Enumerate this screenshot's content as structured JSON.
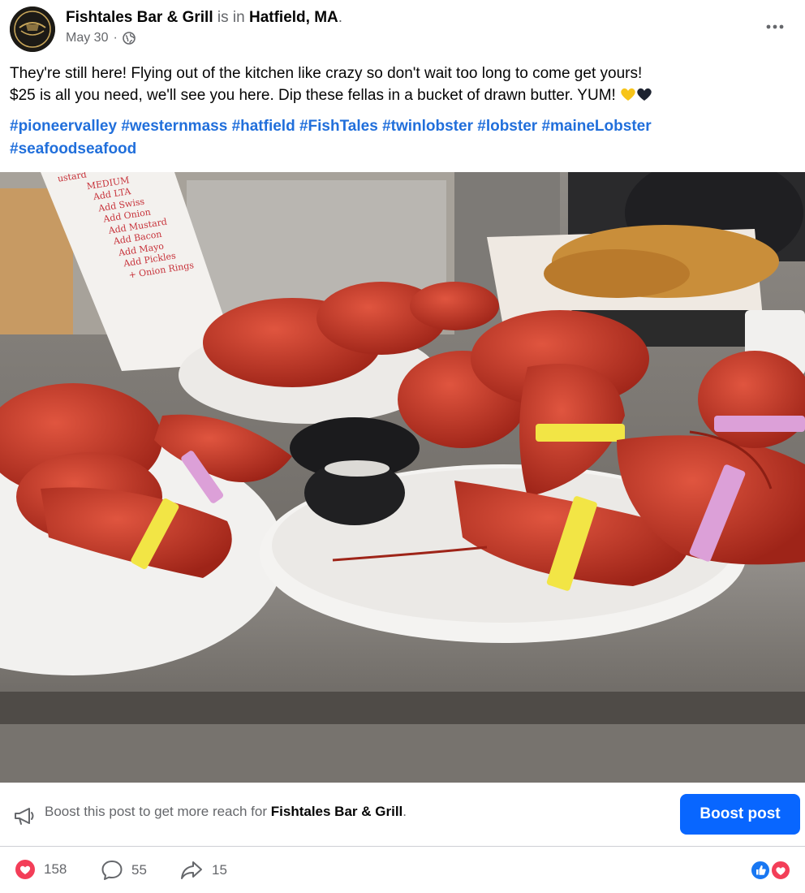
{
  "post": {
    "author": "Fishtales Bar & Grill",
    "is_in_text": "is in",
    "location": "Hatfield, MA",
    "period": ".",
    "date": "May 30",
    "dot": "·",
    "audience_icon": "globe-icon",
    "more_icon": "more-options-icon",
    "text_line1": "They're still here! Flying out of the kitchen like crazy so don't wait too long to come get yours!",
    "text_line2": "$25 is all you need, we'll see you here. Dip these fellas in a bucket of drawn butter. YUM!",
    "emojis": [
      "yellow-heart-icon",
      "black-heart-icon"
    ],
    "hashtags": [
      "#pioneervalley",
      "#westernmass",
      "#hatfield",
      "#FishTales",
      "#twinlobster",
      "#lobster",
      "#maineLobster",
      "#seafoodseafood"
    ]
  },
  "photo": {
    "menu_card_lines": [
      "ustard",
      "MEDIUM",
      "Add LTA",
      "Add Swiss",
      "Add Onion",
      "Add Mustard",
      "Add Bacon",
      "Add Mayo",
      "Add Pickles",
      "+ Onion Rings"
    ]
  },
  "boost": {
    "prefix": "Boost this post to get more reach for",
    "page": "Fishtales Bar & Grill",
    "suffix": ".",
    "button": "Boost post",
    "icon": "megaphone-icon"
  },
  "stats": {
    "likes": "158",
    "comments": "55",
    "shares": "15",
    "like_icon": "heart-icon",
    "comment_icon": "comment-icon",
    "share_icon": "share-icon",
    "reaction_icons": [
      "like-reaction-icon",
      "love-reaction-icon"
    ]
  },
  "colors": {
    "link": "#216fdb",
    "button": "#0866ff",
    "muted": "#65676b",
    "love": "#f33e58",
    "like": "#1877f2"
  }
}
